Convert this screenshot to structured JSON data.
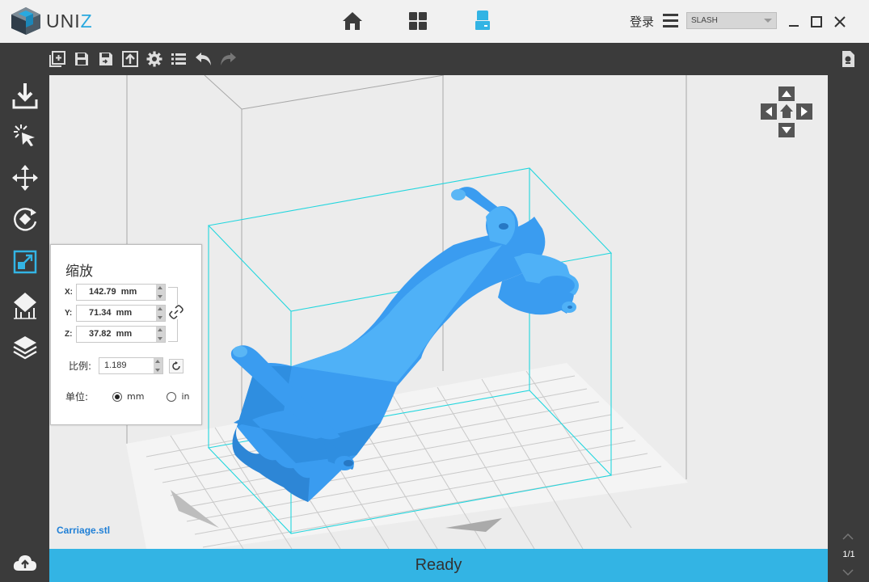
{
  "app": {
    "logo_text": "UNIZ",
    "login_label": "登录",
    "printer": {
      "selected": "SLASH"
    }
  },
  "colors": {
    "accent": "#33b4e4",
    "model": "#3a9cf0",
    "bounding_box": "#22d6de",
    "titlebar": "#f1f1f1",
    "panel_dark": "#3b3b3b"
  },
  "nav": {
    "items": [
      {
        "icon": "home-icon",
        "active": false
      },
      {
        "icon": "grid-icon",
        "active": false
      },
      {
        "icon": "printer-icon",
        "active": true
      }
    ]
  },
  "toolbar": {
    "icons": [
      "add-file-icon",
      "save-icon",
      "save-as-icon",
      "export-icon",
      "settings-icon",
      "list-icon",
      "undo-icon",
      "redo-icon"
    ]
  },
  "left_tools": {
    "icons": [
      "import-icon",
      "select-icon",
      "move-icon",
      "rotate-icon",
      "scale-icon",
      "support-icon",
      "slice-layers-icon",
      "upload-icon"
    ],
    "active": "scale-icon"
  },
  "scale_panel": {
    "title": "缩放",
    "x_label": "X:",
    "x_value": "142.79  mm",
    "y_label": "Y:",
    "y_value": "71.34  mm",
    "z_label": "Z:",
    "z_value": "37.82  mm",
    "ratio_label": "比例:",
    "ratio_value": "1.189",
    "unit_label": "单位:",
    "unit_mm": "mm",
    "unit_in": "in",
    "unit_selected": "mm"
  },
  "viewport": {
    "filename": "Carriage.stl"
  },
  "pager": {
    "text": "1/1"
  },
  "status": {
    "text": "Ready"
  }
}
